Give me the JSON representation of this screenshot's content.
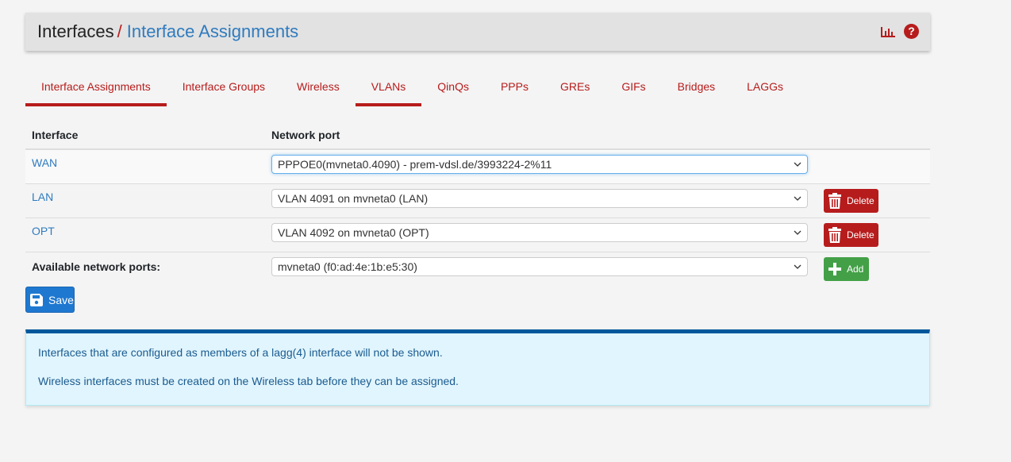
{
  "header": {
    "breadcrumb_root": "Interfaces",
    "separator": "/",
    "breadcrumb_current": "Interface Assignments",
    "icons": [
      "chart-icon",
      "help-icon"
    ],
    "accent_color": "#b71c1c"
  },
  "tabs": [
    {
      "label": "Interface Assignments",
      "active": true
    },
    {
      "label": "Interface Groups",
      "active": false
    },
    {
      "label": "Wireless",
      "active": false
    },
    {
      "label": "VLANs",
      "active": true
    },
    {
      "label": "QinQs",
      "active": false
    },
    {
      "label": "PPPs",
      "active": false
    },
    {
      "label": "GREs",
      "active": false
    },
    {
      "label": "GIFs",
      "active": false
    },
    {
      "label": "Bridges",
      "active": false
    },
    {
      "label": "LAGGs",
      "active": false
    }
  ],
  "table": {
    "headers": {
      "interface": "Interface",
      "network_port": "Network port"
    },
    "rows": [
      {
        "interface": "WAN",
        "port": "PPPOE0(mvneta0.4090) - prem-vdsl.de/3993224-2%11",
        "action": null
      },
      {
        "interface": "LAN",
        "port": "VLAN 4091 on mvneta0 (LAN)",
        "action": "Delete"
      },
      {
        "interface": "OPT",
        "port": "VLAN 4092 on mvneta0 (OPT)",
        "action": "Delete"
      }
    ],
    "available": {
      "label": "Available network ports:",
      "port": "mvneta0 (f0:ad:4e:1b:e5:30)",
      "action": "Add"
    }
  },
  "save_label": "Save",
  "info": {
    "line1": "Interfaces that are configured as members of a lagg(4) interface will not be shown.",
    "line2": "Wireless interfaces must be created on the Wireless tab before they can be assigned."
  }
}
